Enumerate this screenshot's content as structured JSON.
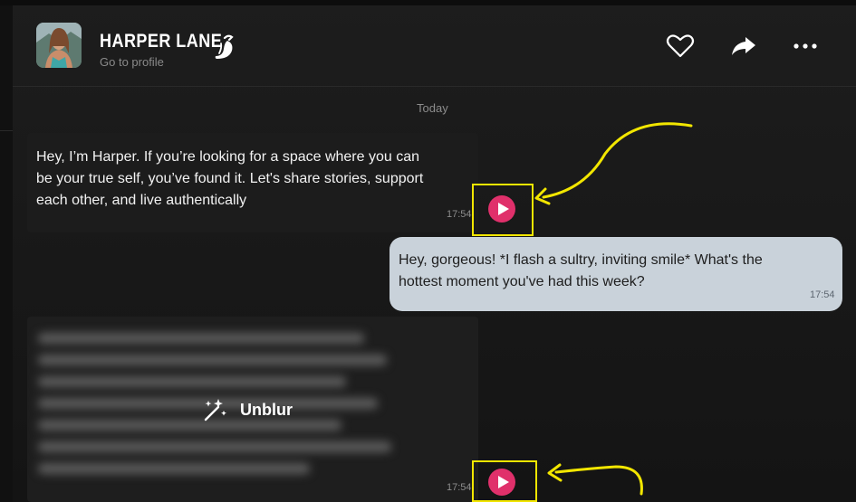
{
  "header": {
    "name": "HARPER LANE",
    "profile_link": "Go to profile",
    "icons": [
      "pepper-icon",
      "heart-icon",
      "share-icon",
      "more-icon"
    ]
  },
  "chat": {
    "date_separator": "Today",
    "messages": [
      {
        "from": "Harper",
        "text": "Hey, I’m Harper. If you’re looking for a space where you can be your true self, you’ve found it. Let's share stories, support each other, and live authentically",
        "time": "17:54"
      },
      {
        "from": "user",
        "text": "Hey, gorgeous! *I flash a sultry, inviting smile* What's the hottest moment you've had this week?",
        "time": "17:54"
      },
      {
        "from": "Harper",
        "blurred": true,
        "action_label": "Unblur",
        "time": "17:54"
      }
    ]
  },
  "colors": {
    "accent_play": "#e0306b",
    "annotation": "#f2e600",
    "user_bubble": "#c9d2da"
  }
}
